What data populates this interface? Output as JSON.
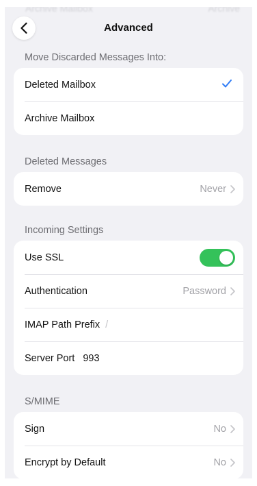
{
  "ghost_row": {
    "label": "Archive Mailbox",
    "value": "Archive"
  },
  "nav": {
    "title": "Advanced"
  },
  "colors": {
    "accent": "#2f7cf6",
    "toggle_on": "#34c25a",
    "background": "#f1f1f5"
  },
  "sections": [
    {
      "header": "Move Discarded Messages Into:",
      "rows": [
        {
          "label": "Deleted Mailbox",
          "selected": true
        },
        {
          "label": "Archive Mailbox",
          "selected": false
        }
      ]
    },
    {
      "header": "Deleted Messages",
      "rows": [
        {
          "label": "Remove",
          "value": "Never"
        }
      ]
    },
    {
      "header": "Incoming Settings",
      "rows": [
        {
          "label": "Use SSL",
          "toggle_on": true
        },
        {
          "label": "Authentication",
          "value": "Password"
        },
        {
          "label": "IMAP Path Prefix",
          "placeholder": "/"
        },
        {
          "label": "Server Port",
          "value": "993"
        }
      ]
    },
    {
      "header": "S/MIME",
      "rows": [
        {
          "label": "Sign",
          "value": "No"
        },
        {
          "label": "Encrypt by Default",
          "value": "No"
        }
      ]
    }
  ]
}
